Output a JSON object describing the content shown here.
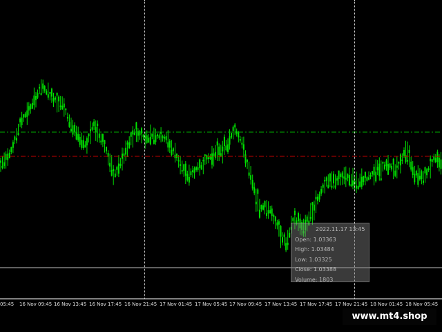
{
  "chart": {
    "background": "#000000",
    "candle_color": "#00e000",
    "green_level_color": "#00b000",
    "red_level_color": "#c00000",
    "separator_color": "#d9d9d9"
  },
  "time_axis": {
    "labels": [
      "05:45",
      "16 Nov 09:45",
      "16 Nov 13:45",
      "16 Nov 17:45",
      "16 Nov 21:45",
      "17 Nov 01:45",
      "17 Nov 05:45",
      "17 Nov 09:45",
      "17 Nov 13:45",
      "17 Nov 17:45",
      "17 Nov 21:45",
      "18 Nov 01:45",
      "18 Nov 05:45"
    ]
  },
  "tooltip": {
    "datetime": "2022.11.17 13:45",
    "open": "Open: 1.03363",
    "high": "High: 1.03484",
    "low": "Low: 1.03325",
    "close": "Close: 1.03388",
    "volume": "Volume: 1803"
  },
  "watermark": "www.mt4.shop"
}
